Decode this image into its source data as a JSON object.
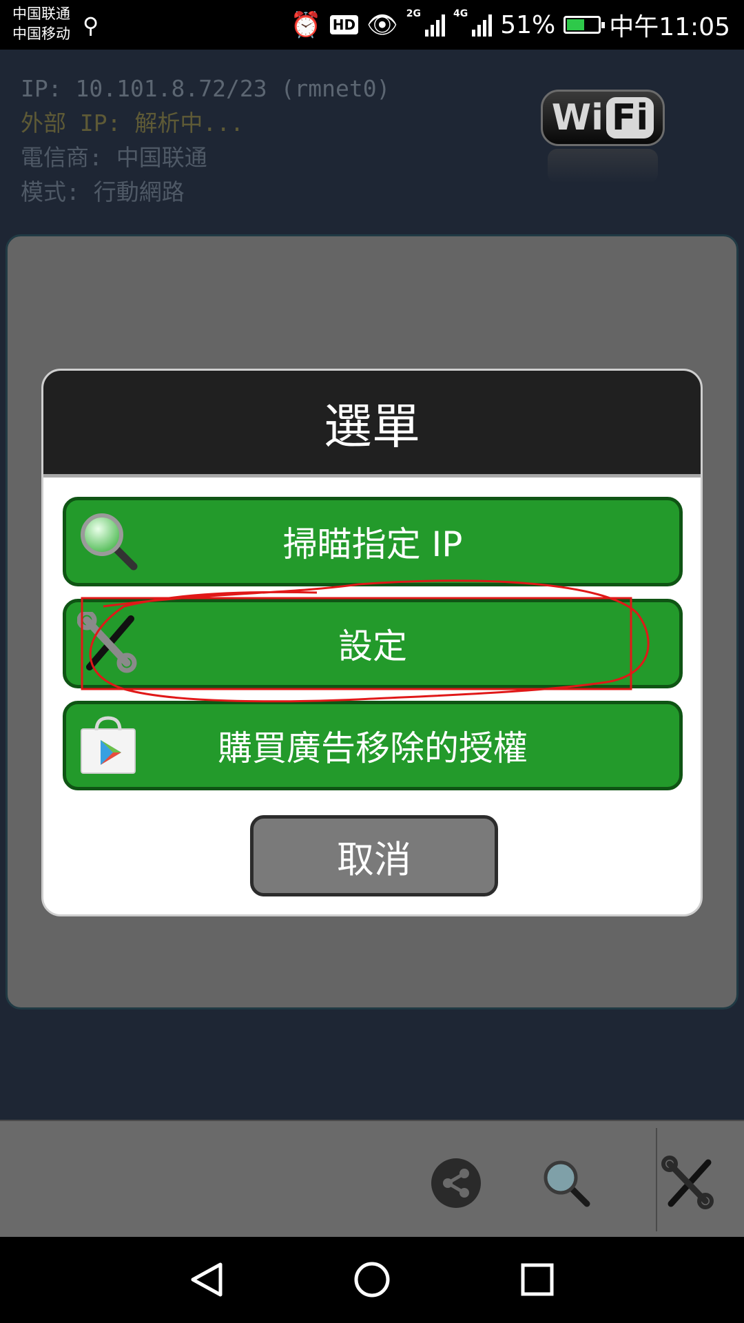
{
  "status_bar": {
    "carrier_1": "中国联通",
    "carrier_2": "中国移动",
    "net_1": "2G",
    "net_2": "4G",
    "battery_text": "51%",
    "battery_level": 0.51,
    "time": "中午11:05"
  },
  "info": {
    "ip": "IP: 10.101.8.72/23 (rmnet0)",
    "external_ip": "外部 IP: 解析中...",
    "carrier": "電信商: 中国联通",
    "mode": "模式: 行動網路",
    "logo_wi": "Wi",
    "logo_fi": "Fi"
  },
  "dialog": {
    "title": "選單",
    "options": [
      {
        "label": "掃瞄指定 IP",
        "icon": "magnifier-icon"
      },
      {
        "label": "設定",
        "icon": "tools-icon"
      },
      {
        "label": "購買廣告移除的授權",
        "icon": "play-store-icon"
      }
    ],
    "cancel": "取消"
  },
  "toolbar": {
    "icons": [
      "share-icon",
      "search-icon",
      "tools-icon"
    ]
  },
  "navbar": {
    "icons": [
      "back-icon",
      "home-icon",
      "recent-apps-icon"
    ]
  },
  "colors": {
    "option_green": "#239a2b",
    "markup_red": "#e01818"
  }
}
